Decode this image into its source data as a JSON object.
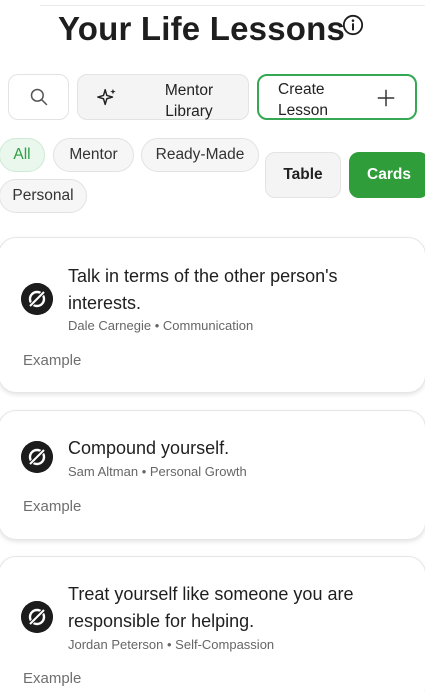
{
  "page": {
    "title": "Your Life Lessons"
  },
  "toolbar": {
    "mentor_label": "Mentor Library",
    "create_label": "Create Lesson"
  },
  "filters": [
    {
      "label": "All",
      "active": true
    },
    {
      "label": "Mentor",
      "active": false
    },
    {
      "label": "Ready-Made",
      "active": false
    },
    {
      "label": "Personal",
      "active": false
    }
  ],
  "view_toggle": {
    "table_label": "Table",
    "cards_label": "Cards",
    "selected": "Cards"
  },
  "lessons": [
    {
      "quote": "Talk in terms of the other person's interests.",
      "author": "Dale Carnegie",
      "category": "Communication",
      "meta": "Dale Carnegie • Communication",
      "example_label": "Example"
    },
    {
      "quote": "Compound yourself.",
      "author": "Sam Altman",
      "category": "Personal Growth",
      "meta": "Sam Altman • Personal Growth",
      "example_label": "Example"
    },
    {
      "quote": "Treat yourself like someone you are responsible for helping.",
      "author": "Jordan Peterson",
      "category": "Self-Compassion",
      "meta": "Jordan Peterson • Self-Compassion",
      "example_label": "Example"
    }
  ],
  "colors": {
    "accent": "#2f9e3a",
    "accent_light": "#e9f7ec",
    "text": "#1f1f1f",
    "muted": "#666666"
  }
}
